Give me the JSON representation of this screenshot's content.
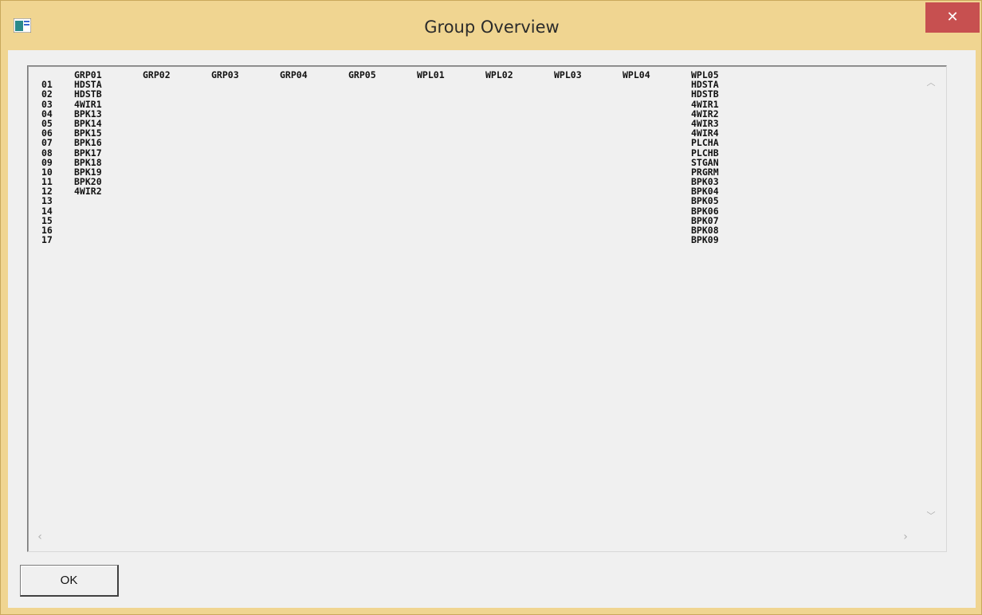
{
  "window": {
    "title": "Group Overview",
    "close_label": "✕",
    "icon": "app-window-icon"
  },
  "table": {
    "headers": [
      "GRP01",
      "GRP02",
      "GRP03",
      "GRP04",
      "GRP05",
      "WPL01",
      "WPL02",
      "WPL03",
      "WPL04",
      "WPL05"
    ],
    "rows": [
      {
        "num": "01",
        "cells": [
          "HDSTA",
          "",
          "",
          "",
          "",
          "",
          "",
          "",
          "",
          "HDSTA"
        ]
      },
      {
        "num": "02",
        "cells": [
          "HDSTB",
          "",
          "",
          "",
          "",
          "",
          "",
          "",
          "",
          "HDSTB"
        ]
      },
      {
        "num": "03",
        "cells": [
          "4WIR1",
          "",
          "",
          "",
          "",
          "",
          "",
          "",
          "",
          "4WIR1"
        ]
      },
      {
        "num": "04",
        "cells": [
          "BPK13",
          "",
          "",
          "",
          "",
          "",
          "",
          "",
          "",
          "4WIR2"
        ]
      },
      {
        "num": "05",
        "cells": [
          "BPK14",
          "",
          "",
          "",
          "",
          "",
          "",
          "",
          "",
          "4WIR3"
        ]
      },
      {
        "num": "06",
        "cells": [
          "BPK15",
          "",
          "",
          "",
          "",
          "",
          "",
          "",
          "",
          "4WIR4"
        ]
      },
      {
        "num": "07",
        "cells": [
          "BPK16",
          "",
          "",
          "",
          "",
          "",
          "",
          "",
          "",
          "PLCHA"
        ]
      },
      {
        "num": "08",
        "cells": [
          "BPK17",
          "",
          "",
          "",
          "",
          "",
          "",
          "",
          "",
          "PLCHB"
        ]
      },
      {
        "num": "09",
        "cells": [
          "BPK18",
          "",
          "",
          "",
          "",
          "",
          "",
          "",
          "",
          "STGAN"
        ]
      },
      {
        "num": "10",
        "cells": [
          "BPK19",
          "",
          "",
          "",
          "",
          "",
          "",
          "",
          "",
          "PRGRM"
        ]
      },
      {
        "num": "11",
        "cells": [
          "BPK20",
          "",
          "",
          "",
          "",
          "",
          "",
          "",
          "",
          "BPK03"
        ]
      },
      {
        "num": "12",
        "cells": [
          "4WIR2",
          "",
          "",
          "",
          "",
          "",
          "",
          "",
          "",
          "BPK04"
        ]
      },
      {
        "num": "13",
        "cells": [
          "",
          "",
          "",
          "",
          "",
          "",
          "",
          "",
          "",
          "BPK05"
        ]
      },
      {
        "num": "14",
        "cells": [
          "",
          "",
          "",
          "",
          "",
          "",
          "",
          "",
          "",
          "BPK06"
        ]
      },
      {
        "num": "15",
        "cells": [
          "",
          "",
          "",
          "",
          "",
          "",
          "",
          "",
          "",
          "BPK07"
        ]
      },
      {
        "num": "16",
        "cells": [
          "",
          "",
          "",
          "",
          "",
          "",
          "",
          "",
          "",
          "BPK08"
        ]
      },
      {
        "num": "17",
        "cells": [
          "",
          "",
          "",
          "",
          "",
          "",
          "",
          "",
          "",
          "BPK09"
        ]
      }
    ]
  },
  "scroll": {
    "up": "︿",
    "down": "﹀",
    "left": "‹",
    "right": "›"
  },
  "buttons": {
    "ok_label": "OK"
  }
}
